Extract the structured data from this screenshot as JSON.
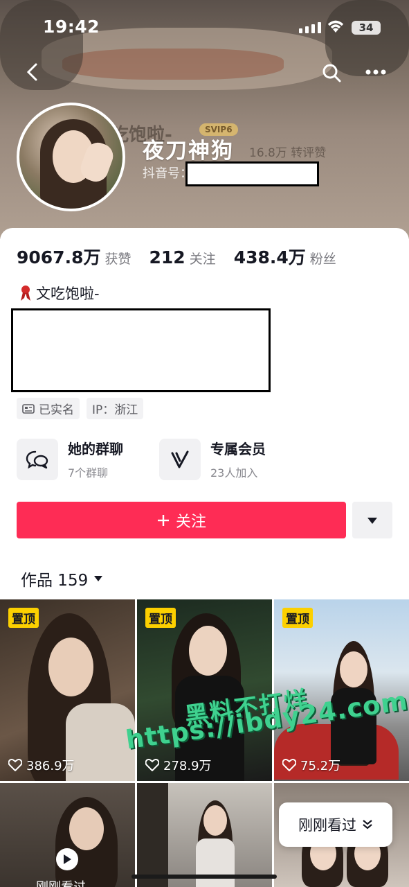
{
  "status_bar": {
    "time": "19:42",
    "battery": "34"
  },
  "profile": {
    "nickname": "夜刀神狗",
    "douyin_id_label": "抖音号：",
    "bg_name_ghost": "吃饱啦-",
    "bg_stat_ghost": "16.8万 转评赞",
    "bg_badge": "SVIP6"
  },
  "stats": [
    {
      "value": "9067.8万",
      "label": "获赞"
    },
    {
      "value": "212",
      "label": "关注"
    },
    {
      "value": "438.4万",
      "label": "粉丝"
    }
  ],
  "bio": {
    "title": "文吃饱啦-"
  },
  "tags": [
    {
      "icon": "id-card-icon",
      "text": "已实名"
    },
    {
      "icon": "",
      "text": "IP：浙江"
    }
  ],
  "features": [
    {
      "icon": "chat-bubbles-icon",
      "title": "她的群聊",
      "subtitle": "7个群聊"
    },
    {
      "icon": "v-membership-icon",
      "title": "专属会员",
      "subtitle": "23人加入"
    }
  ],
  "actions": {
    "follow": "关注"
  },
  "works": {
    "label": "作品 159"
  },
  "videos": [
    {
      "pinned": "置顶",
      "likes": "386.9万"
    },
    {
      "pinned": "置顶",
      "likes": "278.9万"
    },
    {
      "pinned": "置顶",
      "likes": "75.2万"
    }
  ],
  "watermark": {
    "line1": "黑料不打烊",
    "line2": "https://ibdy24.com"
  },
  "recent": {
    "label": "刚刚看过",
    "small": "刚刚看过"
  },
  "colors": {
    "accent": "#fe2c55",
    "pin": "#fcd000",
    "watermark": "#3fd18f"
  }
}
